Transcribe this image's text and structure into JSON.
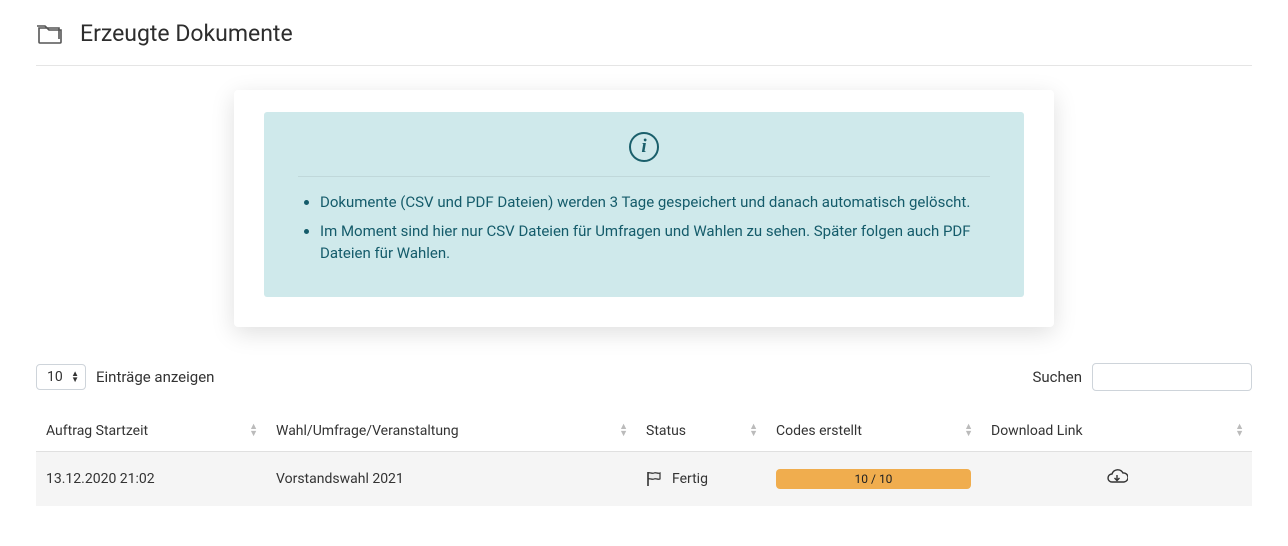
{
  "header": {
    "title": "Erzeugte Dokumente"
  },
  "info": {
    "items": [
      "Dokumente (CSV und PDF Dateien) werden 3 Tage gespeichert und danach automatisch gelöscht.",
      "Im Moment sind hier nur CSV Dateien für Umfragen und Wahlen zu sehen. Später folgen auch PDF Dateien für Wahlen."
    ]
  },
  "controls": {
    "length_value": "10",
    "show_label": "Einträge anzeigen",
    "search_label": "Suchen",
    "search_value": ""
  },
  "table": {
    "headers": {
      "start": "Auftrag Startzeit",
      "event": "Wahl/Umfrage/Veranstaltung",
      "status": "Status",
      "codes": "Codes erstellt",
      "download": "Download Link"
    },
    "rows": [
      {
        "start": "13.12.2020 21:02",
        "event": "Vorstandswahl 2021",
        "status": "Fertig",
        "codes": "10 / 10"
      }
    ]
  }
}
